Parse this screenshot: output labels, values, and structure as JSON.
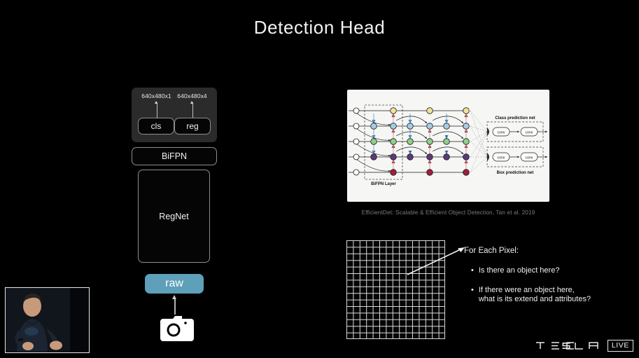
{
  "slide": {
    "title": "Detection Head",
    "background_color": "#000000"
  },
  "pipeline": {
    "output_dims": [
      {
        "label": "640x480x1"
      },
      {
        "label": "640x480x4"
      }
    ],
    "head_boxes": [
      {
        "label": "cls"
      },
      {
        "label": "reg"
      }
    ],
    "neck_label": "BiFPN",
    "backbone_label": "RegNet",
    "input_label": "raw",
    "input_color": "#5e9fb9",
    "camera_icon": "camera-icon"
  },
  "figure": {
    "caption": "EfficientDet: Scalable & Efficient Object Detection, Tan et al. 2019",
    "bifpn_layer_label": "BiFPN Layer",
    "class_net_label": "Class prediction net",
    "box_net_label": "Box prediction net",
    "conv_label": "conv",
    "node_colors": {
      "level_p7": "#efe49a",
      "level_p6": "#a9cbe4",
      "level_p5": "#8fd08a",
      "level_p4": "#5c3a77",
      "level_p3": "#a01f3a",
      "input": "#ffffff"
    },
    "background_color": "#f6f6f4"
  },
  "annotation": {
    "heading": "For Each Pixel:",
    "bullets": [
      {
        "line1": "Is there an object here?",
        "line2": ""
      },
      {
        "line1": "If there were an object here,",
        "line2": "what is its extend and attributes?"
      }
    ],
    "bullet_glyph": "•"
  },
  "grid": {
    "columns": 15,
    "rows": 15,
    "line_color": "#d8d8d8"
  },
  "footer": {
    "brand": "TESLA",
    "brand_letters": [
      "T",
      "E",
      "S",
      "L",
      "A"
    ],
    "live_label": "LIVE"
  },
  "webcam": {
    "alt": "presenter-video"
  }
}
